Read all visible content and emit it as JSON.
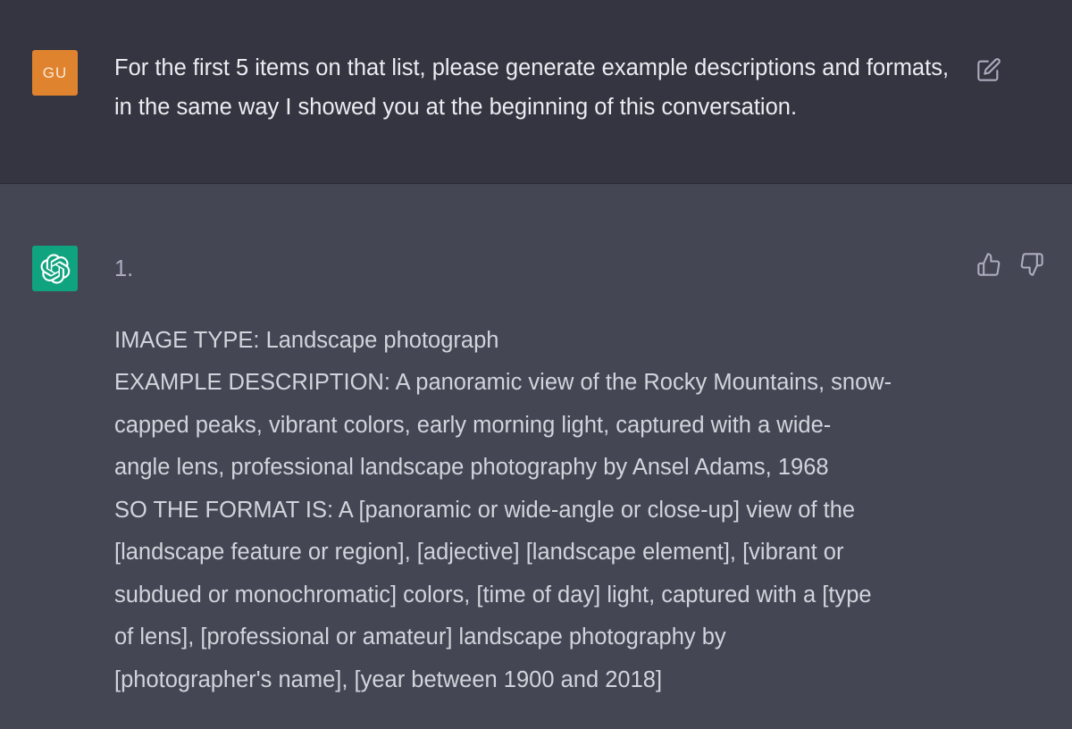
{
  "user_message": {
    "avatar_initials": "GU",
    "avatar_color": "#e0832f",
    "text": "For the first 5 items on that list, please generate example descriptions and formats, in the same way I showed you at the beginning of this conversation.",
    "edit_icon": "edit-icon"
  },
  "assistant_message": {
    "avatar_icon": "openai-logo-icon",
    "avatar_color": "#10a37f",
    "list_number": "1.",
    "lines": [
      "IMAGE TYPE: Landscape photograph",
      "EXAMPLE DESCRIPTION: A panoramic view of the Rocky Mountains, snow-",
      "capped peaks, vibrant colors, early morning light, captured with a wide-",
      "angle lens, professional landscape photography by Ansel Adams, 1968",
      "SO THE FORMAT IS: A [panoramic or wide-angle or close-up] view of the",
      "[landscape feature or region], [adjective] [landscape element], [vibrant or",
      "subdued or monochromatic] colors, [time of day] light, captured with a [type",
      "of lens], [professional or amateur] landscape photography by",
      "[photographer's name], [year between 1900 and 2018]"
    ],
    "feedback_icons": [
      "thumbs-up-icon",
      "thumbs-down-icon"
    ]
  }
}
